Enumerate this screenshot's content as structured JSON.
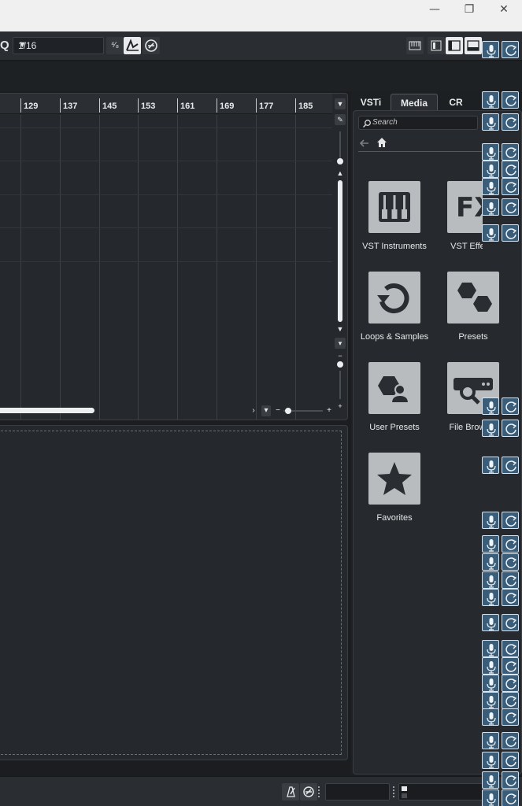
{
  "window": {
    "minimize_glyph": "—",
    "restore_glyph": "❐",
    "close_glyph": "✕"
  },
  "toolbar": {
    "quantize_label": "Q",
    "quantize_value": "1/16",
    "quantize_arrow": "▼",
    "quantize_type_glyph": "⁴⁄₈"
  },
  "ruler": {
    "bars": [
      "129",
      "137",
      "145",
      "153",
      "161",
      "169",
      "177",
      "185"
    ]
  },
  "right_panel": {
    "tabs": [
      "VSTi",
      "Media",
      "CR"
    ],
    "active_tab": "Media",
    "search_placeholder": "Search",
    "tiles": [
      {
        "label": "VST Instruments",
        "icon": "piano-keys-icon"
      },
      {
        "label": "VST Effects",
        "icon": "fx-icon",
        "text": "FX"
      },
      {
        "label": "Loops & Samples",
        "icon": "loop-arrow-icon"
      },
      {
        "label": "Presets",
        "icon": "hexagons-icon"
      },
      {
        "label": "User Presets",
        "icon": "user-hexagon-icon"
      },
      {
        "label": "File Browser",
        "icon": "file-browser-search-icon"
      },
      {
        "label": "Favorites",
        "icon": "star-icon"
      }
    ]
  },
  "colors": {
    "background": "#1b1d20",
    "panel": "#25282c",
    "tile": "#b9bcbf",
    "tile_glyph": "#2a2d31",
    "overlay_button": "#3a5d7a"
  }
}
